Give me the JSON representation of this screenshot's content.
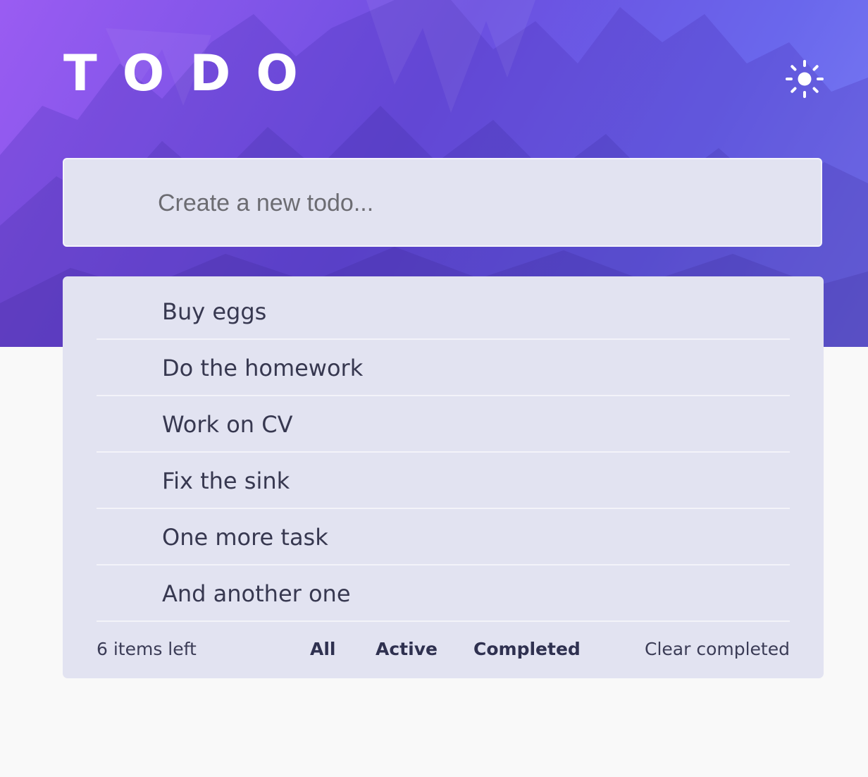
{
  "app": {
    "title": "TODO"
  },
  "header": {
    "theme_toggle_icon": "sun-icon"
  },
  "new_todo": {
    "placeholder": "Create a new todo...",
    "value": ""
  },
  "todos": [
    {
      "text": "Buy eggs"
    },
    {
      "text": "Do the homework"
    },
    {
      "text": "Work on CV"
    },
    {
      "text": "Fix the sink"
    },
    {
      "text": "One more task"
    },
    {
      "text": "And another one"
    }
  ],
  "footer": {
    "items_left": "6 items left",
    "filters": [
      {
        "label": "All"
      },
      {
        "label": "Active"
      },
      {
        "label": "Completed"
      }
    ],
    "clear_completed": "Clear completed"
  },
  "colors": {
    "gradient_start": "#9a5cf2",
    "gradient_end": "#7b80f5",
    "card_background": "#e2e3f1",
    "page_background": "#f9f9f9",
    "text_primary": "#373850"
  }
}
